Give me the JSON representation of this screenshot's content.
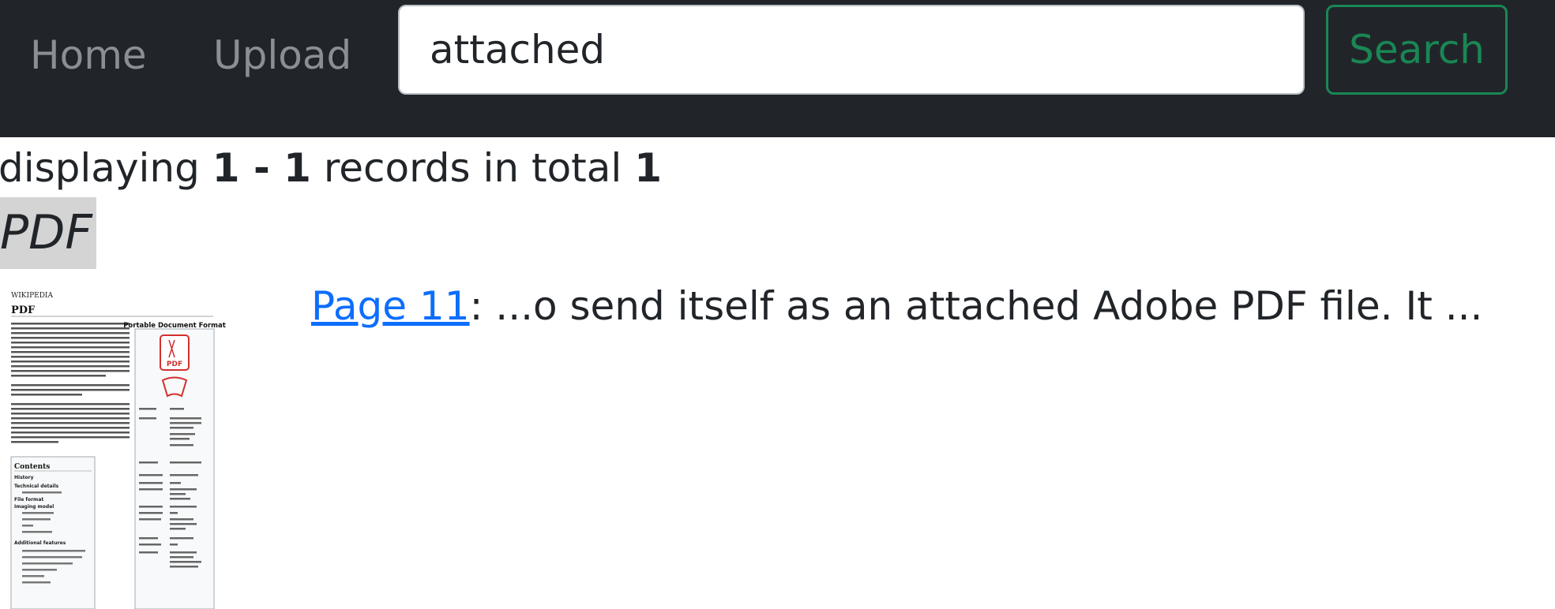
{
  "navbar": {
    "home_label": "Home",
    "upload_label": "Upload",
    "search_value": "attached",
    "search_button_label": "Search"
  },
  "summary": {
    "prefix": "displaying ",
    "range_start": "1",
    "range_sep": " - ",
    "range_end": "1",
    "middle": " records in total ",
    "total": "1"
  },
  "result": {
    "title": "PDF",
    "page_link": "Page 11",
    "snippet": ": ...o send itself as an attached Adobe PDF file. It ..."
  },
  "thumbnail": {
    "site_name": "WIKIPEDIA",
    "heading": "PDF",
    "infobox_title": "Portable Document Format",
    "icon_text": "PDF",
    "contents_title": "Contents",
    "contents_items": [
      "History",
      "Technical details",
      "File format",
      "Imaging model",
      "Additional features"
    ]
  }
}
